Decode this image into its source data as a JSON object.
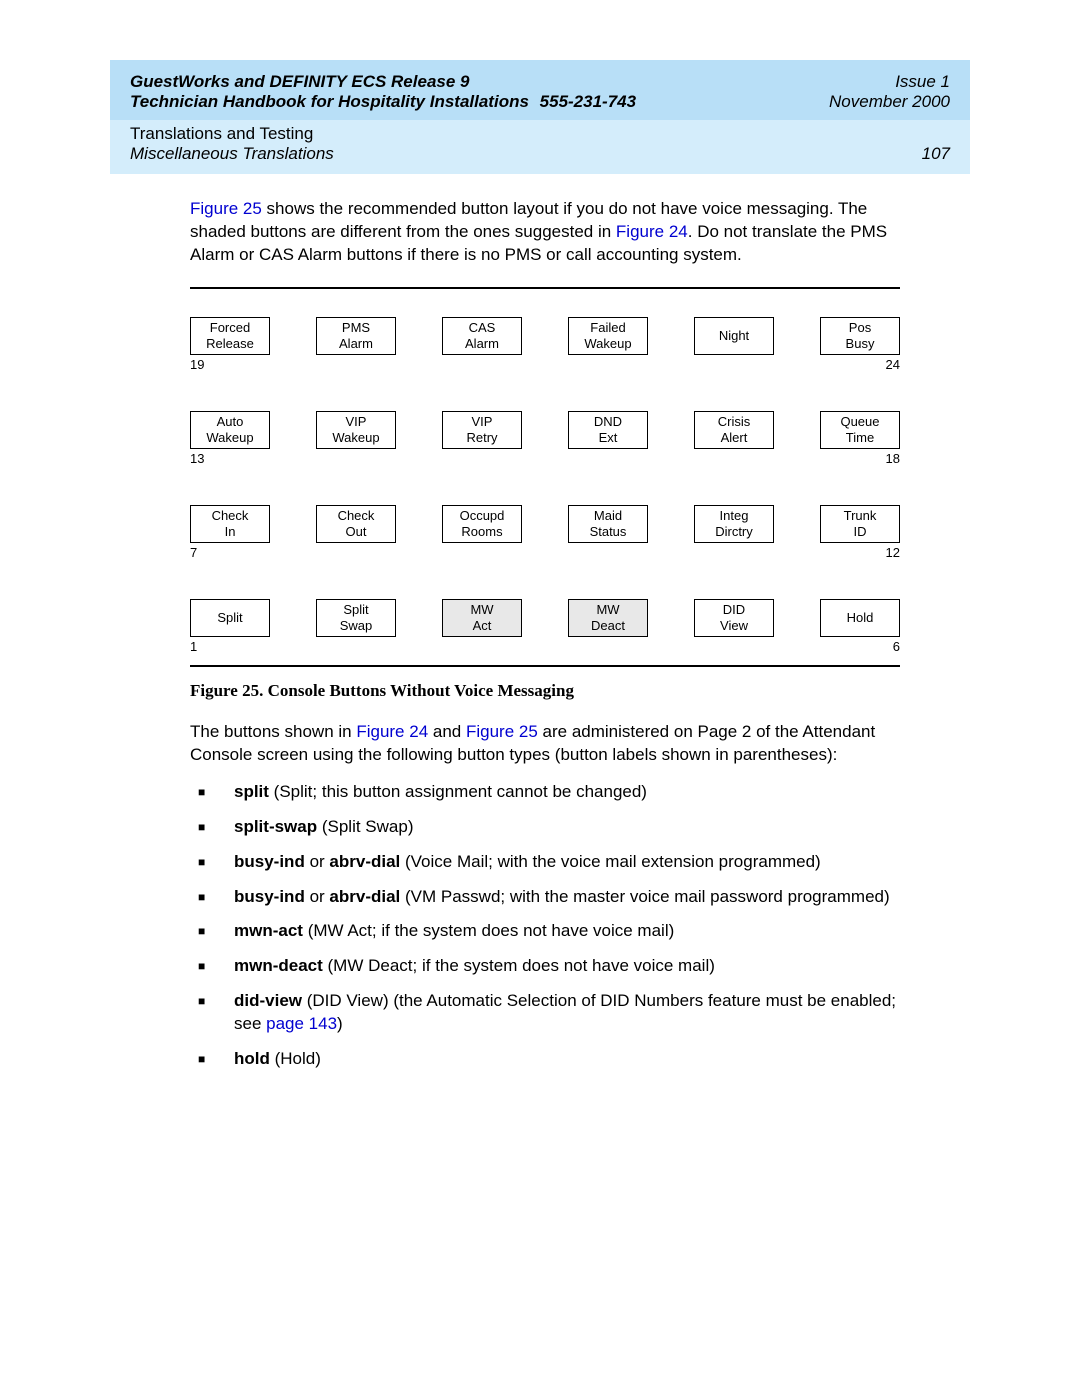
{
  "header": {
    "product": "GuestWorks and DEFINITY ECS Release 9",
    "handbook": "Technician Handbook for Hospitality Installations",
    "docnum": "555-231-743",
    "issue": "Issue 1",
    "date": "November 2000"
  },
  "subheader": {
    "chapter": "Translations and Testing",
    "section": "Miscellaneous Translations",
    "page": "107"
  },
  "intro": {
    "fig25": "Figure 25",
    "p1a": " shows the recommended button layout if you do not have voice messaging. The shaded buttons are different from the ones suggested in ",
    "fig24": "Figure 24",
    "p1b": ". Do not translate the PMS Alarm or CAS Alarm buttons if there is no PMS or call accounting system."
  },
  "button_rows": [
    {
      "left_num": "19",
      "right_num": "24",
      "buttons": [
        {
          "l1": "Forced",
          "l2": "Release",
          "shaded": false
        },
        {
          "l1": "PMS",
          "l2": "Alarm",
          "shaded": false
        },
        {
          "l1": "CAS",
          "l2": "Alarm",
          "shaded": false
        },
        {
          "l1": "Failed",
          "l2": "Wakeup",
          "shaded": false
        },
        {
          "l1": "Night",
          "l2": "",
          "shaded": false
        },
        {
          "l1": "Pos",
          "l2": "Busy",
          "shaded": false
        }
      ]
    },
    {
      "left_num": "13",
      "right_num": "18",
      "buttons": [
        {
          "l1": "Auto",
          "l2": "Wakeup",
          "shaded": false
        },
        {
          "l1": "VIP",
          "l2": "Wakeup",
          "shaded": false
        },
        {
          "l1": "VIP",
          "l2": "Retry",
          "shaded": false
        },
        {
          "l1": "DND",
          "l2": "Ext",
          "shaded": false
        },
        {
          "l1": "Crisis",
          "l2": "Alert",
          "shaded": false
        },
        {
          "l1": "Queue",
          "l2": "Time",
          "shaded": false
        }
      ]
    },
    {
      "left_num": "7",
      "right_num": "12",
      "buttons": [
        {
          "l1": "Check",
          "l2": "In",
          "shaded": false
        },
        {
          "l1": "Check",
          "l2": "Out",
          "shaded": false
        },
        {
          "l1": "Occupd",
          "l2": "Rooms",
          "shaded": false
        },
        {
          "l1": "Maid",
          "l2": "Status",
          "shaded": false
        },
        {
          "l1": "Integ",
          "l2": "Dirctry",
          "shaded": false
        },
        {
          "l1": "Trunk",
          "l2": "ID",
          "shaded": false
        }
      ]
    },
    {
      "left_num": "1",
      "right_num": "6",
      "buttons": [
        {
          "l1": "Split",
          "l2": "",
          "shaded": false
        },
        {
          "l1": "Split",
          "l2": "Swap",
          "shaded": false
        },
        {
          "l1": "MW",
          "l2": "Act",
          "shaded": true
        },
        {
          "l1": "MW",
          "l2": "Deact",
          "shaded": true
        },
        {
          "l1": "DID",
          "l2": "View",
          "shaded": false
        },
        {
          "l1": "Hold",
          "l2": "",
          "shaded": false
        }
      ]
    }
  ],
  "figure_caption": "Figure 25.  Console Buttons Without Voice Messaging",
  "after_figure": {
    "p1a": "The buttons shown in ",
    "fig24": "Figure 24",
    "p1b": " and ",
    "fig25": "Figure 25",
    "p1c": " are administered on Page 2 of the Attendant Console screen using the following button types (button labels shown in parentheses):"
  },
  "bullets": [
    {
      "b": "split",
      "rest": " (Split; this button assignment cannot be changed)"
    },
    {
      "b": "split-swap",
      "rest": " (Split Swap)"
    },
    {
      "b": "busy-ind",
      "mid": " or ",
      "b2": "abrv-dial",
      "rest": " (Voice Mail; with the voice mail extension programmed)"
    },
    {
      "b": "busy-ind",
      "mid": " or ",
      "b2": "abrv-dial",
      "rest": " (VM Passwd; with the master voice mail password programmed)"
    },
    {
      "b": "mwn-act",
      "rest": " (MW Act; if the system does not have voice mail)"
    },
    {
      "b": "mwn-deact",
      "rest": " (MW Deact; if the system does not have voice mail)"
    },
    {
      "b": "did-view",
      "rest": " (DID View) (the Automatic Selection of DID Numbers feature must be enabled; see ",
      "link": "page 143",
      "after": ")"
    },
    {
      "b": "hold",
      "rest": " (Hold)"
    }
  ]
}
